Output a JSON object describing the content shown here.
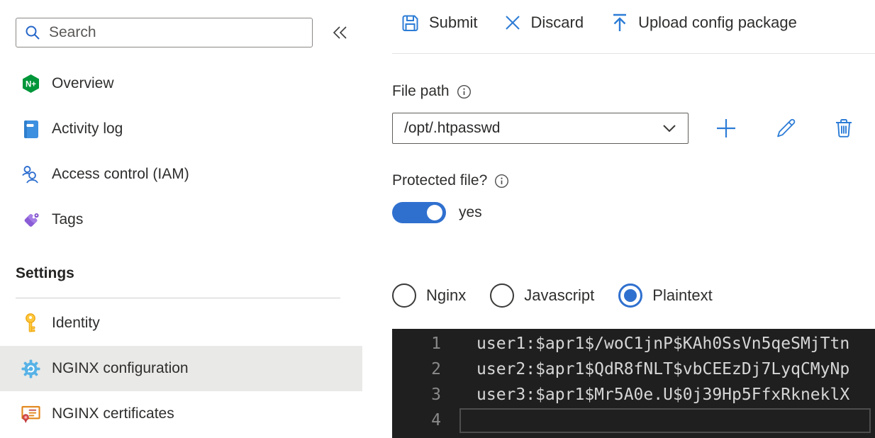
{
  "sidebar": {
    "search_placeholder": "Search",
    "nav_items": [
      {
        "label": "Overview",
        "icon": "nginx-plus-badge-icon"
      },
      {
        "label": "Activity log",
        "icon": "activity-log-book-icon"
      },
      {
        "label": "Access control (IAM)",
        "icon": "people-icon"
      },
      {
        "label": "Tags",
        "icon": "tag-icon"
      }
    ],
    "settings_header": "Settings",
    "settings_items": [
      {
        "label": "Identity",
        "icon": "key-icon",
        "selected": false
      },
      {
        "label": "NGINX configuration",
        "icon": "gear-sync-icon",
        "selected": true
      },
      {
        "label": "NGINX certificates",
        "icon": "certificate-icon",
        "selected": false
      }
    ]
  },
  "toolbar": {
    "submit": "Submit",
    "discard": "Discard",
    "upload": "Upload config package"
  },
  "form": {
    "file_path_label": "File path",
    "file_path_value": "/opt/.htpasswd",
    "protected_label": "Protected file?",
    "protected_value": "yes",
    "protected_on": true
  },
  "syntax_options": [
    {
      "label": "Nginx",
      "selected": false
    },
    {
      "label": "Javascript",
      "selected": false
    },
    {
      "label": "Plaintext",
      "selected": true
    }
  ],
  "editor": {
    "active_line": 4,
    "lines": [
      {
        "number": "1",
        "text": "user1:$apr1$/woC1jnP$KAh0SsVn5qeSMjTtn"
      },
      {
        "number": "2",
        "text": "user2:$apr1$QdR8fNLT$vbCEEzDj7LyqCMyNp"
      },
      {
        "number": "3",
        "text": "user3:$apr1$Mr5A0e.U$0j39Hp5FfxRkneklX"
      },
      {
        "number": "4",
        "text": ""
      }
    ]
  },
  "colors": {
    "accent_blue": "#2c7cd6",
    "control_blue": "#2f70cf",
    "nginx_green": "#009639",
    "selected_nav_bg": "#e9e9e7",
    "editor_bg": "#1f1f1f",
    "editor_text": "#d6d6d6",
    "editor_line_number": "#8a8a8a"
  }
}
